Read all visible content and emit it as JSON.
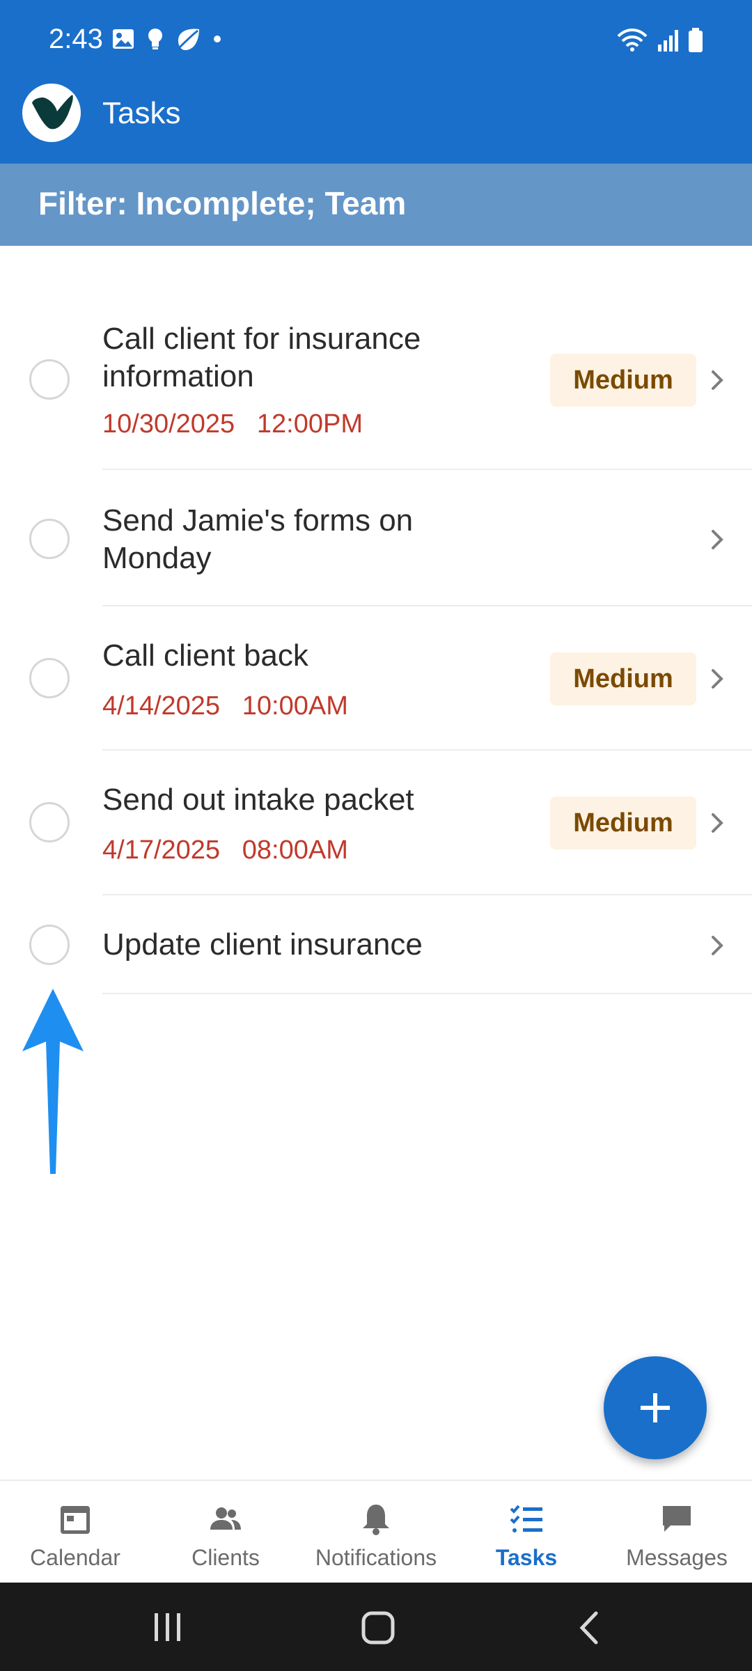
{
  "status_bar": {
    "time": "2:43",
    "icons_left": [
      "image-icon",
      "bulb-icon",
      "leaf-icon",
      "dot-icon"
    ],
    "icons_right": [
      "wifi-icon",
      "signal-icon",
      "battery-icon"
    ]
  },
  "app_bar": {
    "title": "Tasks",
    "logo": "app-logo"
  },
  "filter": {
    "text": "Filter: Incomplete; Team"
  },
  "tasks": [
    {
      "title": "Call client for insurance information",
      "date": "10/30/2025",
      "time": "12:00PM",
      "priority": "Medium"
    },
    {
      "title": "Send Jamie's forms on Monday",
      "date": "",
      "time": "",
      "priority": ""
    },
    {
      "title": "Call client back",
      "date": "4/14/2025",
      "time": "10:00AM",
      "priority": "Medium"
    },
    {
      "title": "Send out intake packet",
      "date": "4/17/2025",
      "time": "08:00AM",
      "priority": "Medium"
    },
    {
      "title": "Update client insurance",
      "date": "",
      "time": "",
      "priority": ""
    }
  ],
  "fab": {
    "icon": "plus-icon"
  },
  "bottom_nav": [
    {
      "label": "Calendar",
      "icon": "calendar-icon",
      "active": false
    },
    {
      "label": "Clients",
      "icon": "clients-icon",
      "active": false
    },
    {
      "label": "Notifications",
      "icon": "bell-icon",
      "active": false
    },
    {
      "label": "Tasks",
      "icon": "tasks-icon",
      "active": true
    },
    {
      "label": "Messages",
      "icon": "message-icon",
      "active": false
    }
  ],
  "system_nav": {
    "icons": [
      "recents-icon",
      "home-icon",
      "back-icon"
    ]
  },
  "colors": {
    "primary": "#1a6fca",
    "filter_bar": "#6496c8",
    "date_text": "#c0392b",
    "badge_bg": "#fdf2e3",
    "badge_text": "#7a4a00",
    "annotation_arrow": "#1e8ff0"
  }
}
